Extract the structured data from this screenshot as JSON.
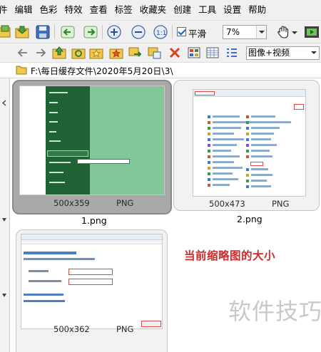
{
  "menu": [
    "件",
    "编辑",
    "色彩",
    "特效",
    "查看",
    "标签",
    "收藏夹",
    "创建",
    "工具",
    "设置",
    "帮助"
  ],
  "toolbar": {
    "smooth_label": "平滑",
    "smooth_checked": true,
    "zoom_value": "7%",
    "view_mode": "图像+视频"
  },
  "address": {
    "path": "F:\\每日缓存文件\\2020年5月20日\\3\\"
  },
  "thumbnails": [
    {
      "filename": "1.png",
      "dimensions": "500x359",
      "format": "PNG",
      "selected": true
    },
    {
      "filename": "2.png",
      "dimensions": "500x473",
      "format": "PNG",
      "selected": false
    },
    {
      "filename": "",
      "dimensions": "500x362",
      "format": "PNG",
      "selected": false
    }
  ],
  "annotation": "当前缩略图的大小",
  "watermark": "软件技巧",
  "colors": {
    "annotation": "#d22a2a",
    "selected_thumb_bg": "#a9a9a9",
    "thumb_bg": "#f2f2f2",
    "screenshot_green": "#82c79a"
  },
  "icons": [
    "new-folder-icon",
    "open-folder-icon",
    "save-icon",
    "back-icon",
    "forward-icon",
    "zoom-in-icon",
    "zoom-out-icon",
    "actual-size-icon",
    "hand-icon",
    "slideshow-icon",
    "nav-back-icon",
    "nav-forward-icon",
    "up-folder-icon",
    "refresh-icon",
    "favorite-icon",
    "add-favorite-icon",
    "move-icon",
    "copy-icon",
    "delete-icon",
    "thumbnails-view-icon",
    "grid-view-icon",
    "details-view-icon",
    "folder-icon"
  ]
}
